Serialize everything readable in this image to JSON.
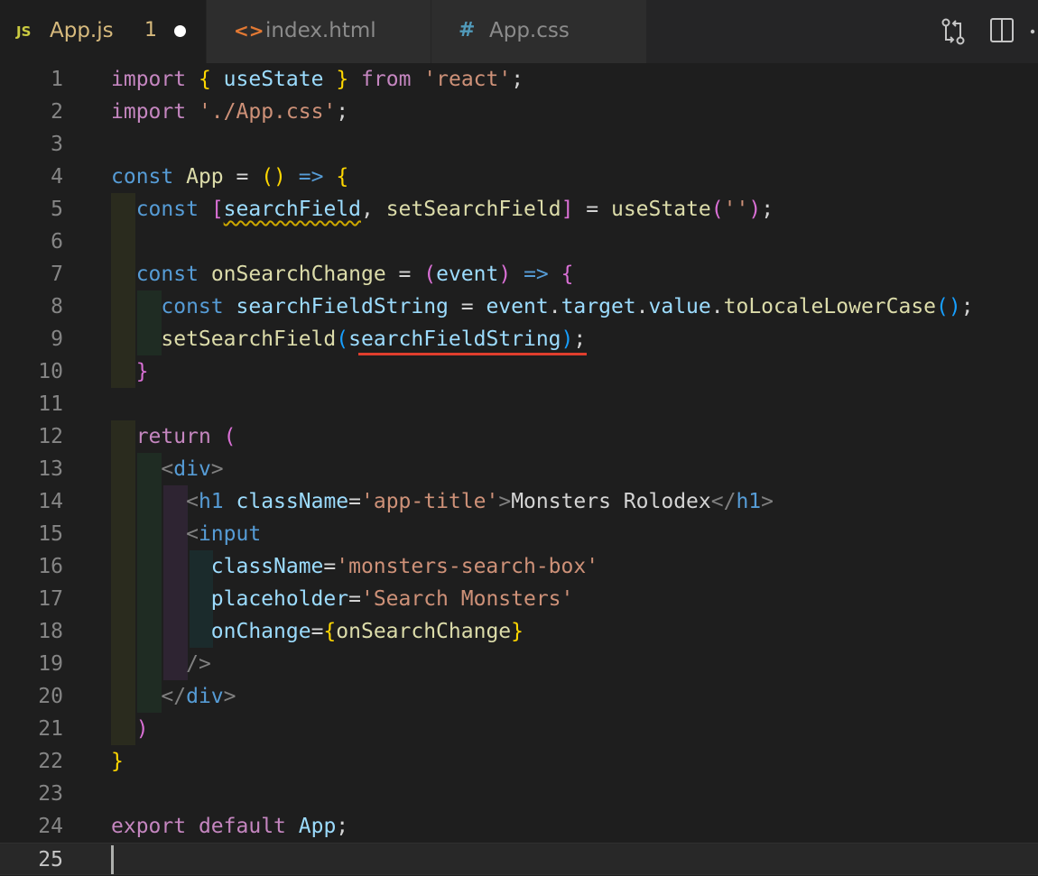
{
  "tabs": [
    {
      "icon": "js-file-icon",
      "icon_text": "JS",
      "label": "App.js",
      "badge": "1",
      "modified": true,
      "active": true
    },
    {
      "icon": "html-file-icon",
      "icon_text": "<>",
      "label": "index.html",
      "active": false
    },
    {
      "icon": "css-file-icon",
      "icon_text": "#",
      "label": "App.css",
      "active": false
    }
  ],
  "toolbar": {
    "actions": [
      "compare-changes-icon",
      "split-editor-icon",
      "more-actions-icon"
    ]
  },
  "editor": {
    "current_line": 25,
    "problem_count": "1",
    "lines": [
      {
        "n": "1",
        "text": "import { useState } from 'react';"
      },
      {
        "n": "2",
        "text": "import './App.css';"
      },
      {
        "n": "3",
        "text": ""
      },
      {
        "n": "4",
        "text": "const App = () => {"
      },
      {
        "n": "5",
        "text": "  const [searchField, setSearchField] = useState('');"
      },
      {
        "n": "6",
        "text": ""
      },
      {
        "n": "7",
        "text": "  const onSearchChange = (event) => {"
      },
      {
        "n": "8",
        "text": "    const searchFieldString = event.target.value.toLocaleLowerCase();"
      },
      {
        "n": "9",
        "text": "    setSearchField(searchFieldString);"
      },
      {
        "n": "10",
        "text": "  }"
      },
      {
        "n": "11",
        "text": ""
      },
      {
        "n": "12",
        "text": "  return ("
      },
      {
        "n": "13",
        "text": "    <div>"
      },
      {
        "n": "14",
        "text": "      <h1 className='app-title'>Monsters Rolodex</h1>"
      },
      {
        "n": "15",
        "text": "      <input"
      },
      {
        "n": "16",
        "text": "        className='monsters-search-box'"
      },
      {
        "n": "17",
        "text": "        placeholder='Search Monsters'"
      },
      {
        "n": "18",
        "text": "        onChange={onSearchChange}"
      },
      {
        "n": "19",
        "text": "      />"
      },
      {
        "n": "20",
        "text": "    </div>"
      },
      {
        "n": "21",
        "text": "  )"
      },
      {
        "n": "22",
        "text": "}"
      },
      {
        "n": "23",
        "text": ""
      },
      {
        "n": "24",
        "text": "export default App;"
      },
      {
        "n": "25",
        "text": ""
      }
    ]
  },
  "colors": {
    "editor_bg": "#1e1e1e",
    "tabbar_bg": "#252526",
    "active_tab_label": "#d7ba7d",
    "keyword": "#569cd6",
    "control": "#c586c0",
    "string": "#ce9178",
    "function": "#dcdcaa",
    "variable": "#9cdcfe",
    "bracket_1": "#ffd700",
    "bracket_2": "#da70d6",
    "bracket_3": "#179fff",
    "error_underline": "#e03e2d",
    "warning_squiggle": "#cca700"
  }
}
